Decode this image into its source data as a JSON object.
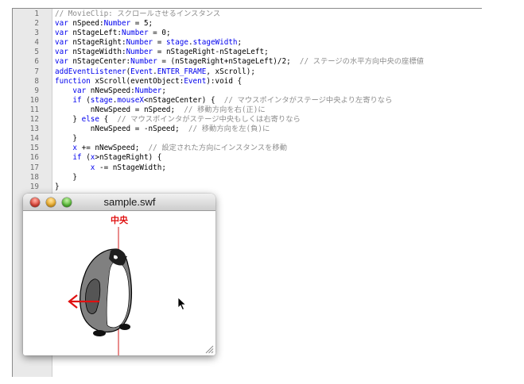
{
  "editor": {
    "lines": [
      {
        "no": "1",
        "tokens": [
          {
            "t": "// MovieClip: スクロールさせるインスタンス",
            "c": "cm"
          }
        ]
      },
      {
        "no": "2",
        "tokens": [
          {
            "t": "var",
            "c": "kw"
          },
          {
            "t": " nSpeed:",
            "c": "plain"
          },
          {
            "t": "Number",
            "c": "type"
          },
          {
            "t": " = 5;",
            "c": "plain"
          }
        ]
      },
      {
        "no": "3",
        "tokens": [
          {
            "t": "var",
            "c": "kw"
          },
          {
            "t": " nStageLeft:",
            "c": "plain"
          },
          {
            "t": "Number",
            "c": "type"
          },
          {
            "t": " = 0;",
            "c": "plain"
          }
        ]
      },
      {
        "no": "4",
        "tokens": [
          {
            "t": "var",
            "c": "kw"
          },
          {
            "t": " nStageRight:",
            "c": "plain"
          },
          {
            "t": "Number",
            "c": "type"
          },
          {
            "t": " = ",
            "c": "plain"
          },
          {
            "t": "stage",
            "c": "kw"
          },
          {
            "t": ".",
            "c": "plain"
          },
          {
            "t": "stageWidth",
            "c": "kw"
          },
          {
            "t": ";",
            "c": "plain"
          }
        ]
      },
      {
        "no": "5",
        "tokens": [
          {
            "t": "var",
            "c": "kw"
          },
          {
            "t": " nStageWidth:",
            "c": "plain"
          },
          {
            "t": "Number",
            "c": "type"
          },
          {
            "t": " = nStageRight-nStageLeft;",
            "c": "plain"
          }
        ]
      },
      {
        "no": "6",
        "tokens": [
          {
            "t": "var",
            "c": "kw"
          },
          {
            "t": " nStageCenter:",
            "c": "plain"
          },
          {
            "t": "Number",
            "c": "type"
          },
          {
            "t": " = (nStageRight+nStageLeft)/2;  ",
            "c": "plain"
          },
          {
            "t": "// ステージの水平方向中央の座標値",
            "c": "cm"
          }
        ]
      },
      {
        "no": "7",
        "tokens": [
          {
            "t": "addEventListener",
            "c": "kw"
          },
          {
            "t": "(",
            "c": "plain"
          },
          {
            "t": "Event",
            "c": "kw"
          },
          {
            "t": ".",
            "c": "plain"
          },
          {
            "t": "ENTER_FRAME",
            "c": "kw"
          },
          {
            "t": ", xScroll);",
            "c": "plain"
          }
        ]
      },
      {
        "no": "8",
        "tokens": [
          {
            "t": "function",
            "c": "kw"
          },
          {
            "t": " xScroll(eventObject:",
            "c": "plain"
          },
          {
            "t": "Event",
            "c": "type"
          },
          {
            "t": "):",
            "c": "plain"
          },
          {
            "t": "void",
            "c": "plain"
          },
          {
            "t": " {",
            "c": "plain"
          }
        ]
      },
      {
        "no": "9",
        "tokens": [
          {
            "t": "    ",
            "c": "plain"
          },
          {
            "t": "var",
            "c": "kw"
          },
          {
            "t": " nNewSpeed:",
            "c": "plain"
          },
          {
            "t": "Number",
            "c": "type"
          },
          {
            "t": ";",
            "c": "plain"
          }
        ]
      },
      {
        "no": "10",
        "tokens": [
          {
            "t": "    ",
            "c": "plain"
          },
          {
            "t": "if",
            "c": "kw"
          },
          {
            "t": " (",
            "c": "plain"
          },
          {
            "t": "stage",
            "c": "kw"
          },
          {
            "t": ".",
            "c": "plain"
          },
          {
            "t": "mouseX",
            "c": "kw"
          },
          {
            "t": "<nStageCenter) {  ",
            "c": "plain"
          },
          {
            "t": "// マウスポインタがステージ中央より左寄りなら",
            "c": "cm"
          }
        ]
      },
      {
        "no": "11",
        "tokens": [
          {
            "t": "        nNewSpeed = nSpeed;  ",
            "c": "plain"
          },
          {
            "t": "// 移動方向を右(正)に",
            "c": "cm"
          }
        ]
      },
      {
        "no": "12",
        "tokens": [
          {
            "t": "    } ",
            "c": "plain"
          },
          {
            "t": "else",
            "c": "kw"
          },
          {
            "t": " {  ",
            "c": "plain"
          },
          {
            "t": "// マウスポインタがステージ中央もしくは右寄りなら",
            "c": "cm"
          }
        ]
      },
      {
        "no": "13",
        "tokens": [
          {
            "t": "        nNewSpeed = -nSpeed;  ",
            "c": "plain"
          },
          {
            "t": "// 移動方向を左(負)に",
            "c": "cm"
          }
        ]
      },
      {
        "no": "14",
        "tokens": [
          {
            "t": "    }",
            "c": "plain"
          }
        ]
      },
      {
        "no": "15",
        "tokens": [
          {
            "t": "    ",
            "c": "plain"
          },
          {
            "t": "x",
            "c": "kw"
          },
          {
            "t": " += nNewSpeed;  ",
            "c": "plain"
          },
          {
            "t": "// 設定された方向にインスタンスを移動",
            "c": "cm"
          }
        ]
      },
      {
        "no": "16",
        "tokens": [
          {
            "t": "    ",
            "c": "plain"
          },
          {
            "t": "if",
            "c": "kw"
          },
          {
            "t": " (",
            "c": "plain"
          },
          {
            "t": "x",
            "c": "kw"
          },
          {
            "t": ">nStageRight) {",
            "c": "plain"
          }
        ]
      },
      {
        "no": "17",
        "tokens": [
          {
            "t": "        ",
            "c": "plain"
          },
          {
            "t": "x",
            "c": "kw"
          },
          {
            "t": " -= nStageWidth;",
            "c": "plain"
          }
        ]
      },
      {
        "no": "18",
        "tokens": [
          {
            "t": "    }",
            "c": "plain"
          }
        ]
      },
      {
        "no": "19",
        "tokens": [
          {
            "t": "}",
            "c": "plain"
          }
        ]
      }
    ]
  },
  "player": {
    "title": "sample.swf",
    "center_label": "中央",
    "accent_color": "#e01010",
    "character_icon": "penguin-icon",
    "arrow_icon": "left-arrow-icon",
    "cursor_icon": "pointer-cursor-icon"
  }
}
